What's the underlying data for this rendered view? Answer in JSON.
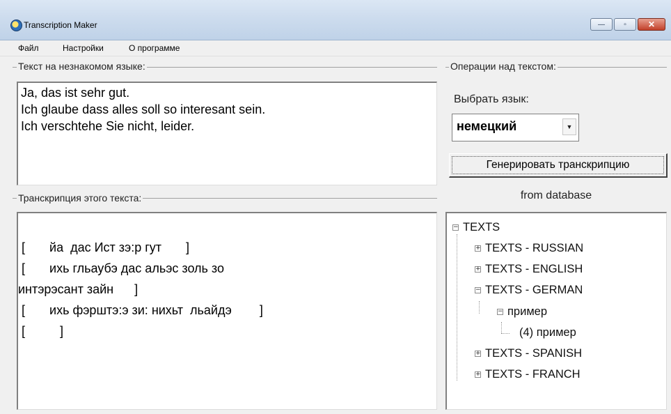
{
  "window": {
    "title": "Transcription Maker",
    "minimize": "—",
    "maximize": "▫",
    "close": "✕"
  },
  "menu": [
    "Файл",
    "Настройки",
    "О программе"
  ],
  "source_group": {
    "label": "Текст на незнакомом языке:",
    "lines": [
      "Ja, das ist sehr gut.",
      "Ich glaube dass alles soll so interesant sein.",
      "Ich verschtehe Sie nicht, leider."
    ]
  },
  "transcription_group": {
    "label": "Транскрипция этого текста:",
    "lines": [
      " [       йа  дас Ист зэ:р гут       ]",
      " [       ихь гльаубэ дас альэс золь зо",
      "интэрэсант зайн      ]",
      " [       ихь фэрштэ:э зи: нихьт  льайдэ        ]",
      " [          ]"
    ]
  },
  "operations_group": {
    "label": "Операции над текстом:",
    "language_label": "Выбрать язык:",
    "language_value": "немецкий",
    "generate_button": "Генерировать транскрипцию"
  },
  "database": {
    "label": "from database",
    "tree": {
      "root": "TEXTS",
      "items": [
        "TEXTS - RUSSIAN",
        "TEXTS - ENGLISH",
        "TEXTS - GERMAN",
        "пример",
        "(4) пример",
        "TEXTS - SPANISH",
        "TEXTS - FRANCH"
      ]
    }
  }
}
